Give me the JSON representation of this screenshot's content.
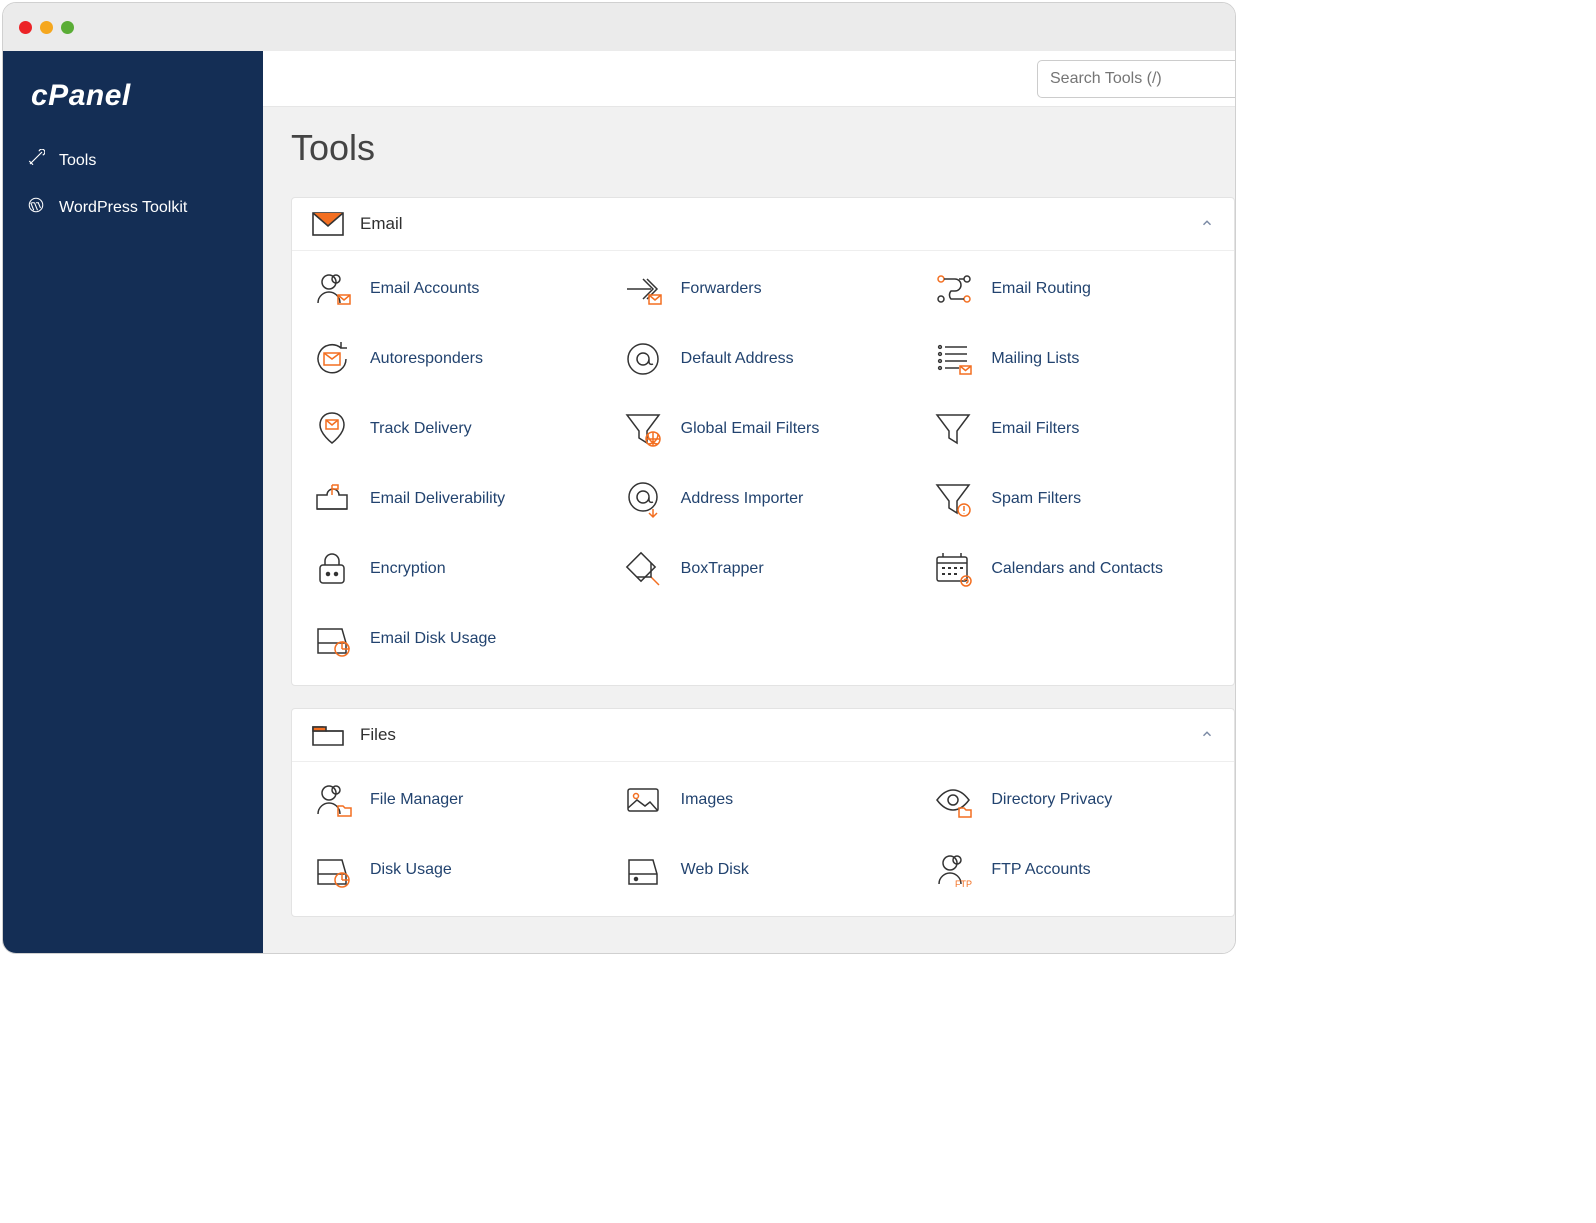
{
  "brand": "cPanel",
  "sidebar": {
    "items": [
      {
        "label": "Tools",
        "icon": "tools-icon"
      },
      {
        "label": "WordPress Toolkit",
        "icon": "wordpress-icon"
      }
    ]
  },
  "search": {
    "placeholder": "Search Tools (/)"
  },
  "page": {
    "title": "Tools"
  },
  "sections": [
    {
      "title": "Email",
      "icon": "envelope-icon",
      "items": [
        {
          "label": "Email Accounts",
          "icon": "email-accounts-icon"
        },
        {
          "label": "Forwarders",
          "icon": "forwarders-icon"
        },
        {
          "label": "Email Routing",
          "icon": "email-routing-icon"
        },
        {
          "label": "Autoresponders",
          "icon": "autoresponders-icon"
        },
        {
          "label": "Default Address",
          "icon": "default-address-icon"
        },
        {
          "label": "Mailing Lists",
          "icon": "mailing-lists-icon"
        },
        {
          "label": "Track Delivery",
          "icon": "track-delivery-icon"
        },
        {
          "label": "Global Email Filters",
          "icon": "global-filters-icon"
        },
        {
          "label": "Email Filters",
          "icon": "email-filters-icon"
        },
        {
          "label": "Email Deliverability",
          "icon": "deliverability-icon"
        },
        {
          "label": "Address Importer",
          "icon": "address-importer-icon"
        },
        {
          "label": "Spam Filters",
          "icon": "spam-filters-icon"
        },
        {
          "label": "Encryption",
          "icon": "encryption-icon"
        },
        {
          "label": "BoxTrapper",
          "icon": "boxtrapper-icon"
        },
        {
          "label": "Calendars and Contacts",
          "icon": "calendars-icon"
        },
        {
          "label": "Email Disk Usage",
          "icon": "email-disk-usage-icon"
        }
      ]
    },
    {
      "title": "Files",
      "icon": "folder-icon",
      "items": [
        {
          "label": "File Manager",
          "icon": "file-manager-icon"
        },
        {
          "label": "Images",
          "icon": "images-icon"
        },
        {
          "label": "Directory Privacy",
          "icon": "directory-privacy-icon"
        },
        {
          "label": "Disk Usage",
          "icon": "disk-usage-icon"
        },
        {
          "label": "Web Disk",
          "icon": "web-disk-icon"
        },
        {
          "label": "FTP Accounts",
          "icon": "ftp-accounts-icon"
        }
      ]
    }
  ]
}
